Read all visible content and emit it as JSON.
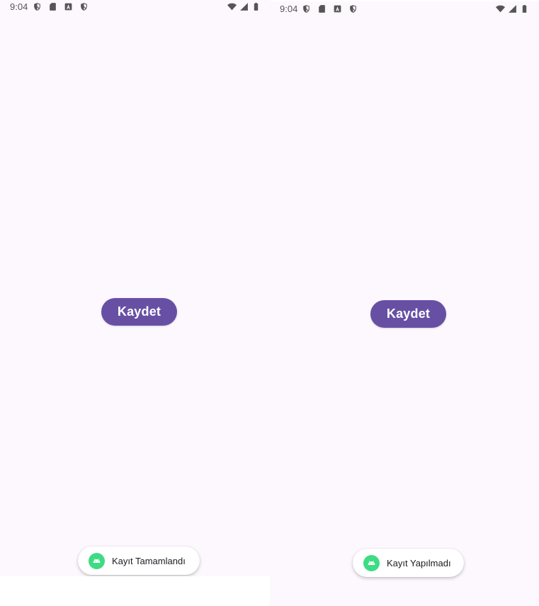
{
  "screens": [
    {
      "status_bar": {
        "time": "9:04",
        "left_icons": [
          "shield-icon",
          "sd-card-icon",
          "app-notification-icon",
          "shield-icon"
        ],
        "right_icons": [
          "wifi-icon",
          "cell-signal-icon",
          "battery-icon"
        ]
      },
      "button": {
        "label": "Kaydet"
      },
      "toast": {
        "icon": "android-icon",
        "text": "Kayıt Tamamlandı"
      }
    },
    {
      "status_bar": {
        "time": "9:04",
        "left_icons": [
          "shield-icon",
          "sd-card-icon",
          "app-notification-icon",
          "shield-icon"
        ],
        "right_icons": [
          "wifi-icon",
          "cell-signal-icon",
          "battery-icon"
        ]
      },
      "button": {
        "label": "Kaydet"
      },
      "toast": {
        "icon": "android-icon",
        "text": "Kayıt Yapılmadı"
      }
    }
  ],
  "colors": {
    "background": "#fdf7fe",
    "button": "#6750a4",
    "button_text": "#ffffff",
    "toast_background": "#ffffff",
    "android_icon": "#3ddc84",
    "status_icons": "#555555"
  }
}
